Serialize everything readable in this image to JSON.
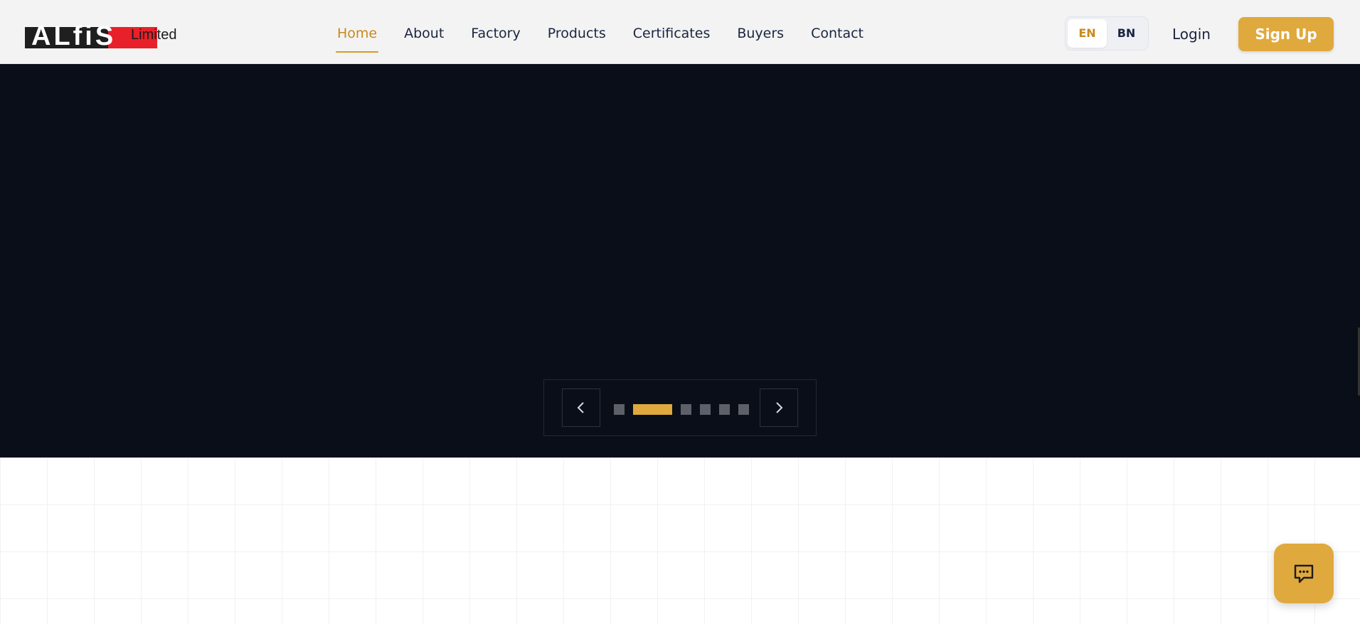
{
  "brand": {
    "logo_letters": "ALfiS",
    "suffix": "Limited"
  },
  "nav": {
    "items": [
      {
        "label": "Home",
        "active": true
      },
      {
        "label": "About",
        "active": false
      },
      {
        "label": "Factory",
        "active": false
      },
      {
        "label": "Products",
        "active": false
      },
      {
        "label": "Certificates",
        "active": false
      },
      {
        "label": "Buyers",
        "active": false
      },
      {
        "label": "Contact",
        "active": false
      }
    ]
  },
  "language": {
    "options": [
      "EN",
      "BN"
    ],
    "selected": "EN"
  },
  "auth": {
    "login_label": "Login",
    "signup_label": "Sign Up"
  },
  "slider": {
    "slide_count": 6,
    "active_index": 1
  },
  "icons": {
    "prev": "chevron-left-icon",
    "next": "chevron-right-icon",
    "chat": "chat-bubble-icon"
  },
  "colors": {
    "accent": "#e0a93d",
    "active_nav": "#c78a1c",
    "nav_text": "#1a2540",
    "hero_bg": "#0a0e18",
    "dot_inactive": "#5d6069"
  }
}
